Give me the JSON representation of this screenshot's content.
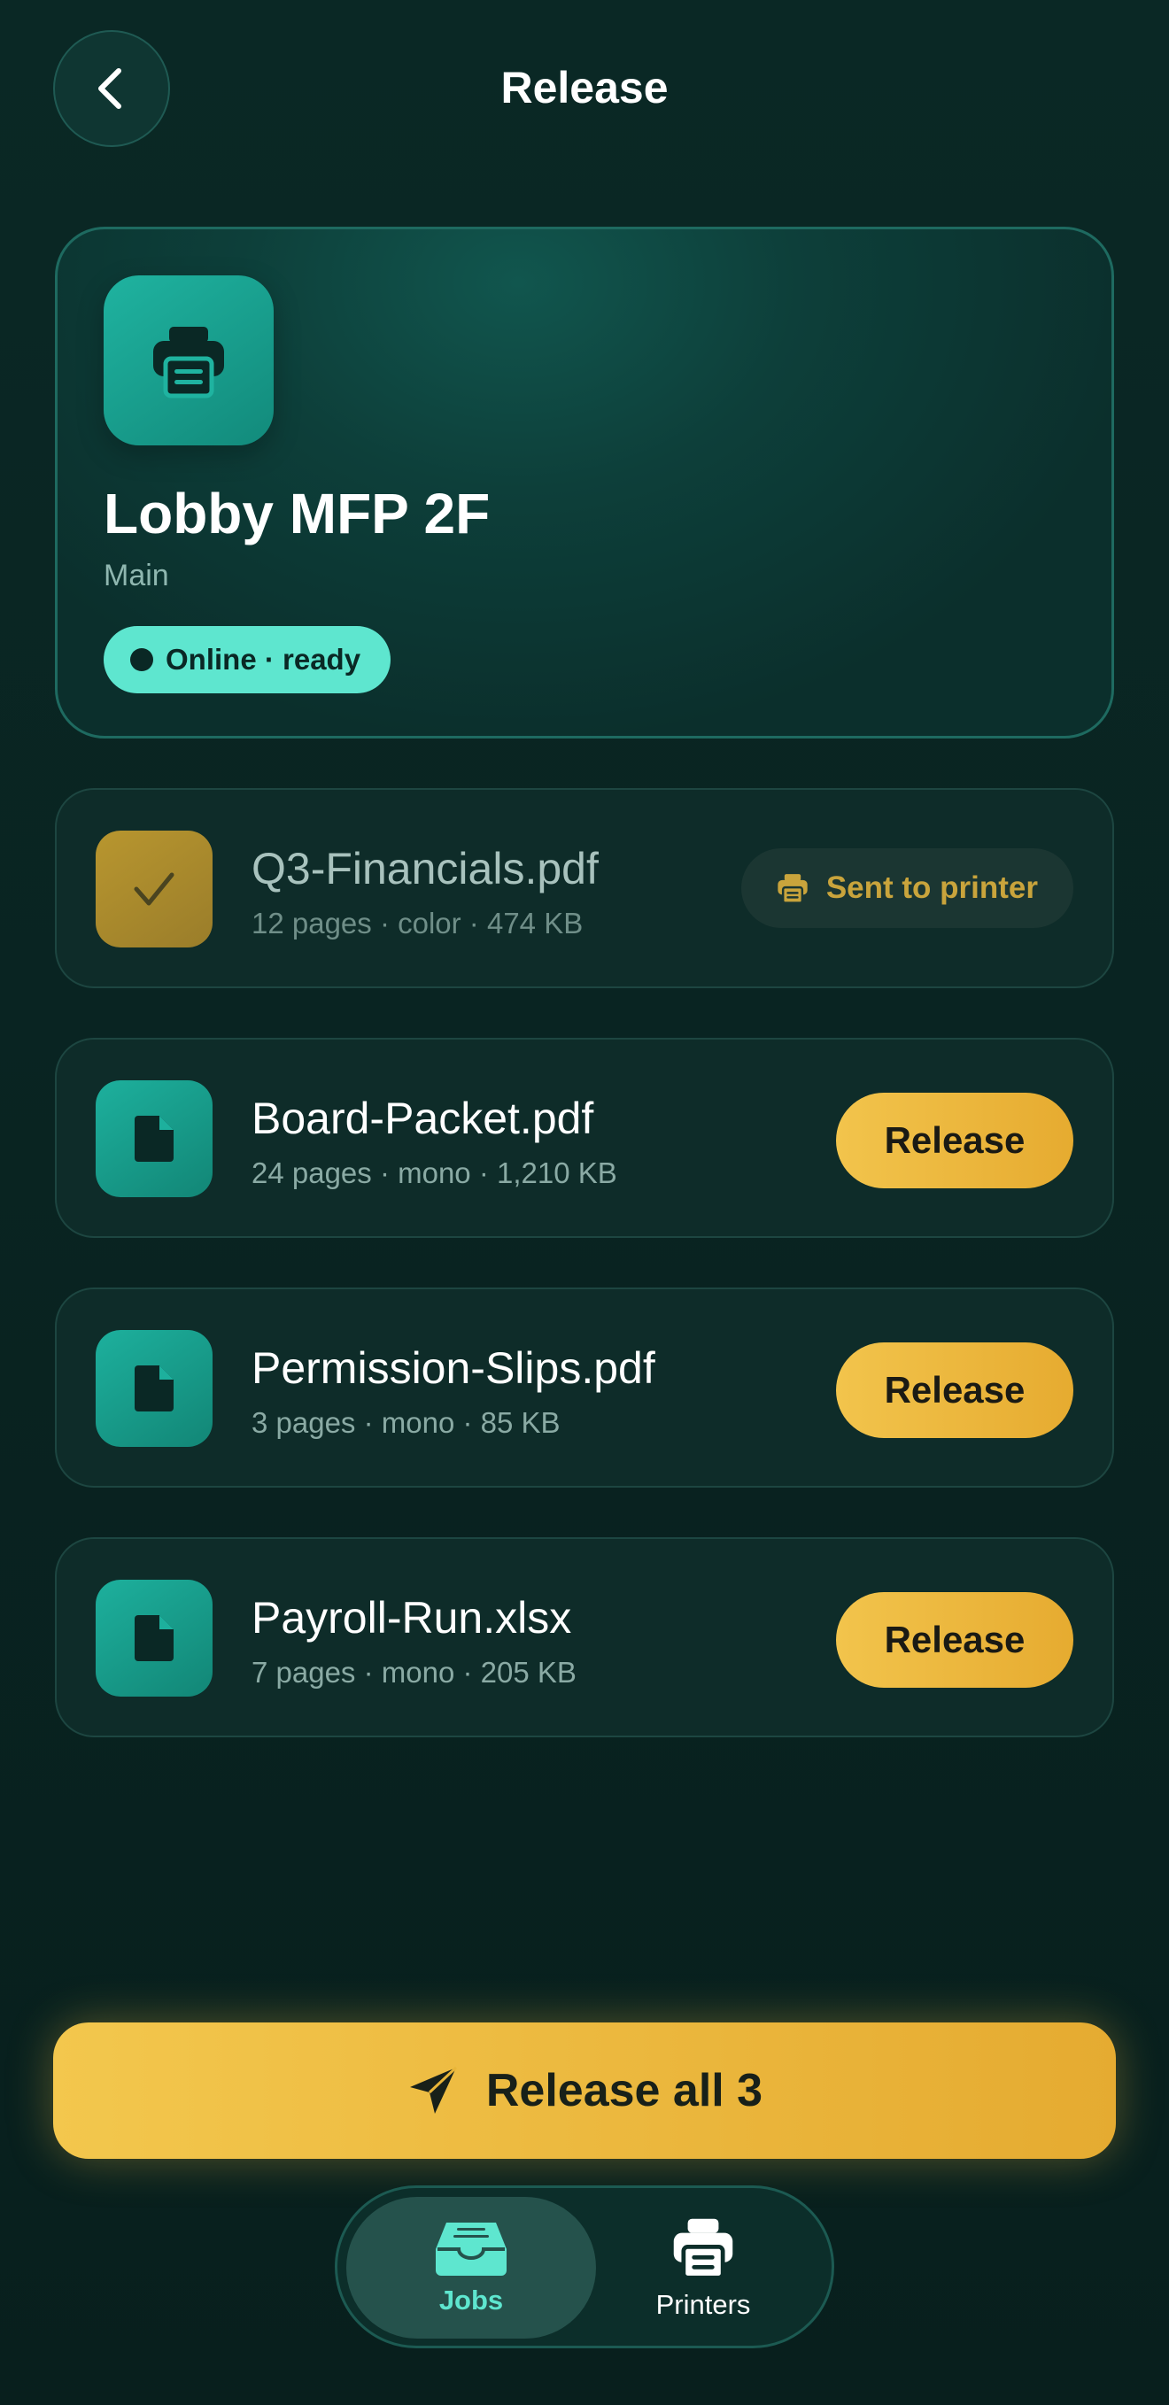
{
  "header": {
    "title": "Release",
    "back_icon": "chevron-left-icon"
  },
  "printer": {
    "name": "Lobby MFP 2F",
    "location": "Main",
    "status": "Online · ready",
    "icon": "printer-icon",
    "status_color": "#5EE6CF"
  },
  "jobs": [
    {
      "name": "Q3-Financials.pdf",
      "meta": "12 pages · color · 474 KB",
      "state": "sent",
      "action_label": "Sent to printer",
      "icon": "check-icon"
    },
    {
      "name": "Board-Packet.pdf",
      "meta": "24 pages · mono · 1,210 KB",
      "state": "pending",
      "action_label": "Release",
      "icon": "document-icon"
    },
    {
      "name": "Permission-Slips.pdf",
      "meta": "3 pages · mono · 85 KB",
      "state": "pending",
      "action_label": "Release",
      "icon": "document-icon"
    },
    {
      "name": "Payroll-Run.xlsx",
      "meta": "7 pages · mono · 205 KB",
      "state": "pending",
      "action_label": "Release",
      "icon": "document-icon"
    }
  ],
  "release_all": {
    "label": "Release all 3",
    "icon": "send-icon"
  },
  "nav": {
    "items": [
      {
        "label": "Jobs",
        "icon": "inbox-icon",
        "active": true
      },
      {
        "label": "Printers",
        "icon": "printer-icon",
        "active": false
      }
    ]
  },
  "colors": {
    "background": "#082522",
    "accent_teal": "#1DB09D",
    "accent_gold": "#F2C44C",
    "status_mint": "#5EE6CF"
  }
}
